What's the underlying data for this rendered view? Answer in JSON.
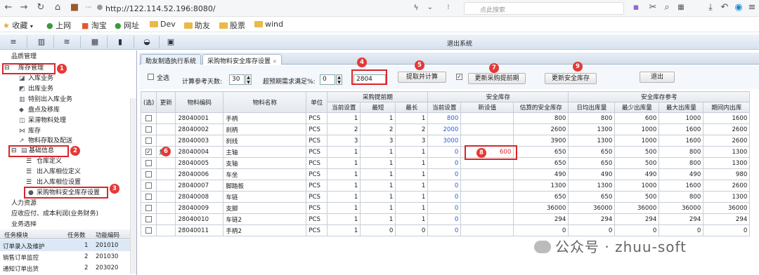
{
  "browser": {
    "url": "http://122.114.52.196:8080/",
    "search_placeholder": "点此搜索"
  },
  "bookmarks": {
    "items": [
      "收藏",
      "上网",
      "淘宝",
      "网址",
      "Dev",
      "助友",
      "股票",
      "wind"
    ]
  },
  "apptoolbar": {
    "logout": "退出系统"
  },
  "sidebar": {
    "items": [
      "品质管理",
      "库存管理",
      "入库业务",
      "出库业务",
      "特别出入库业务",
      "盘点及移库",
      "呆滞物料处理",
      "库存",
      "物料存取及配送",
      "基础信息",
      "仓库定义",
      "出入库相位定义",
      "出入库相位设置",
      "采购物料安全库存设置",
      "人力资源",
      "应收应付、成本利润(业务财务)",
      "业务选择"
    ]
  },
  "taskgrid": {
    "headers": [
      "任务模块",
      "任务数",
      "功能编码"
    ],
    "rows": [
      {
        "module": "订单录入及维护",
        "count": "1",
        "code": "201010"
      },
      {
        "module": "销售订单监控",
        "count": "2",
        "code": "201030"
      },
      {
        "module": "通知订单出货",
        "count": "2",
        "code": "203020"
      }
    ]
  },
  "tabs": [
    "助友制造执行系统",
    "采购物料安全库存设置"
  ],
  "controls": {
    "select_all": "全选",
    "days_label": "计算参考天数:",
    "days_value": "30",
    "exceed_label": "超预期需求满足%:",
    "exceed_value": "0",
    "code_value": "2804",
    "btn_extract": "提取并计算",
    "btn_update_period": "更新采购提前期",
    "btn_update_stock": "更新安全库存",
    "btn_exit": "退出"
  },
  "table": {
    "group_headers": [
      "采购提前期",
      "安全库存",
      "安全库存参考"
    ],
    "headers": [
      "(选)",
      "更新",
      "物料编码",
      "物料名称",
      "单位",
      "当前设置",
      "最短",
      "最长",
      "当前设置",
      "新设值",
      "估算的安全库存",
      "日均出库量",
      "最少出库量",
      "最大出库量",
      "期间内出库"
    ],
    "rows": [
      [
        "",
        "",
        "28040001",
        "手柄",
        "PCS",
        "1",
        "1",
        "1",
        "800",
        "",
        "800",
        "800",
        "600",
        "1000",
        "1600"
      ],
      [
        "",
        "",
        "28040002",
        "刹柄",
        "PCS",
        "2",
        "2",
        "2",
        "2000",
        "",
        "2600",
        "1300",
        "1000",
        "1600",
        "2600"
      ],
      [
        "",
        "",
        "28040003",
        "刹线",
        "PCS",
        "3",
        "3",
        "3",
        "3000",
        "",
        "3900",
        "1300",
        "1000",
        "1600",
        "2600"
      ],
      [
        "",
        "是",
        "28040004",
        "主轴",
        "PCS",
        "1",
        "1",
        "1",
        "0",
        "600",
        "650",
        "650",
        "500",
        "800",
        "1300"
      ],
      [
        "",
        "",
        "28040005",
        "支轴",
        "PCS",
        "1",
        "1",
        "1",
        "0",
        "",
        "650",
        "650",
        "500",
        "800",
        "1300"
      ],
      [
        "",
        "",
        "28040006",
        "车坐",
        "PCS",
        "1",
        "1",
        "1",
        "0",
        "",
        "490",
        "490",
        "490",
        "490",
        "980"
      ],
      [
        "",
        "",
        "28040007",
        "脚踏板",
        "PCS",
        "1",
        "1",
        "1",
        "0",
        "",
        "1300",
        "1300",
        "1000",
        "1600",
        "2600"
      ],
      [
        "",
        "",
        "28040008",
        "车链",
        "PCS",
        "1",
        "1",
        "1",
        "0",
        "",
        "650",
        "650",
        "500",
        "800",
        "1300"
      ],
      [
        "",
        "",
        "28040009",
        "支脚",
        "PCS",
        "1",
        "1",
        "1",
        "0",
        "",
        "36000",
        "36000",
        "36000",
        "36000",
        "36000"
      ],
      [
        "",
        "",
        "28040010",
        "车链2",
        "PCS",
        "1",
        "1",
        "1",
        "0",
        "",
        "294",
        "294",
        "294",
        "294",
        "294"
      ],
      [
        "",
        "",
        "28040011",
        "手柄2",
        "PCS",
        "1",
        "0",
        "0",
        "0",
        "",
        "0",
        "0",
        "0",
        "0",
        "0"
      ]
    ]
  },
  "badges": [
    "1",
    "2",
    "3",
    "4",
    "5",
    "6",
    "7",
    "8",
    "9"
  ],
  "watermark": "公众号 · zhuu-soft",
  "colors": {
    "accent_red": "#d9262a",
    "link_blue": "#2b5bd6"
  }
}
